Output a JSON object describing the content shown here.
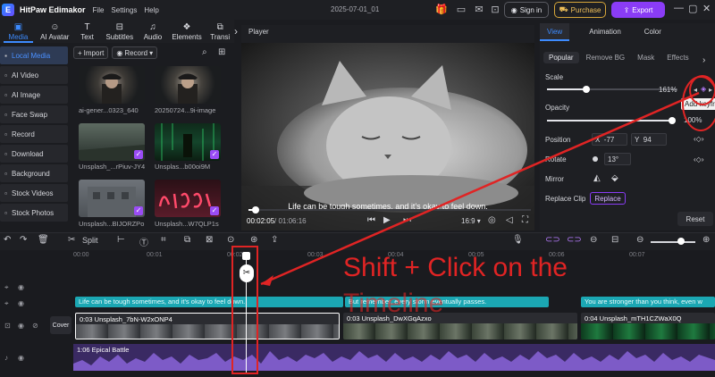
{
  "titlebar": {
    "app_name": "HitPaw Edimakor",
    "menu": [
      "File",
      "Settings",
      "Help"
    ],
    "doc_title": "2025-07-01_01",
    "sign_in": "Sign in",
    "purchase": "Purchase",
    "export": "Export"
  },
  "media_tabs": [
    {
      "label": "Media",
      "icon": "media-icon"
    },
    {
      "label": "AI Avatar",
      "icon": "avatar-icon"
    },
    {
      "label": "Text",
      "icon": "text-icon"
    },
    {
      "label": "Subtitles",
      "icon": "subtitles-icon"
    },
    {
      "label": "Audio",
      "icon": "audio-icon"
    },
    {
      "label": "Elements",
      "icon": "elements-icon"
    },
    {
      "label": "Transi",
      "icon": "transition-icon"
    }
  ],
  "sidebar": {
    "items": [
      "Local Media",
      "AI Video",
      "AI Image",
      "Face Swap",
      "Record",
      "Download",
      "Background",
      "Stock Videos",
      "Stock Photos"
    ]
  },
  "media": {
    "import": "Import",
    "record": "Record",
    "items": [
      {
        "label": "ai-gener...0323_640"
      },
      {
        "label": "20250724...9i-image"
      },
      {
        "label": "Unsplash_...rPiuv-JY4"
      },
      {
        "label": "Unsplas...b00oi9M"
      },
      {
        "label": "Unsplash...BIJORZPo"
      },
      {
        "label": "Unsplash...W7QLP1s"
      }
    ]
  },
  "player": {
    "title": "Player",
    "subtitle": "Life can be tough sometimes, and it’s okay to feel down.",
    "current_time": "00:02:05",
    "total_time": "/ 01:06:16",
    "progress": 0.02,
    "aspect": "16:9"
  },
  "properties": {
    "tabs": [
      "View",
      "Animation",
      "Color"
    ],
    "subtabs": [
      "Popular",
      "Remove BG",
      "Mask",
      "Effects"
    ],
    "scale_label": "Scale",
    "scale_value": "161%",
    "scale_level": 0.3,
    "opacity_label": "Opacity",
    "opacity_value": "100%",
    "opacity_level": 1.0,
    "position_label": "Position",
    "pos_x_label": "X",
    "pos_x": "-77",
    "pos_y_label": "Y",
    "pos_y": "94",
    "rotate_label": "Rotate",
    "rotate_value": "13°",
    "mirror_label": "Mirror",
    "replace_clip_label": "Replace Clip",
    "replace_button": "Replace",
    "reset_button": "Reset",
    "tooltip": "Add keyfra"
  },
  "toolbar": {
    "split": "Split"
  },
  "timeline": {
    "ruler": [
      "00:00",
      "00:01",
      "00:02",
      "00:03",
      "00:04",
      "00:05",
      "00:06",
      "00:07"
    ],
    "cover": "Cover",
    "subtitle_clips": [
      "Life can be tough sometimes, and it’s okay to feel down.",
      "But remember, every storm eventually passes.",
      "You are stronger than you think, even w"
    ],
    "video_clips": [
      "0:03 Unsplash_7bN-W2xONP4",
      "0:03 Unsplash_DwXGqAzxo",
      "0:04 Unsplash_mTH1CZWaX0Q"
    ],
    "audio_clip": "1:06 Epical Battle"
  },
  "annotation": {
    "text_line1": "Shift + Click on the",
    "text_line2": "Timeline",
    "color": "#e02424"
  },
  "colors": {
    "accent": "#3d8bff",
    "export": "#8a3cf6",
    "subtitle_track": "#1ba7b3",
    "audio_track": "#3a2a63"
  }
}
